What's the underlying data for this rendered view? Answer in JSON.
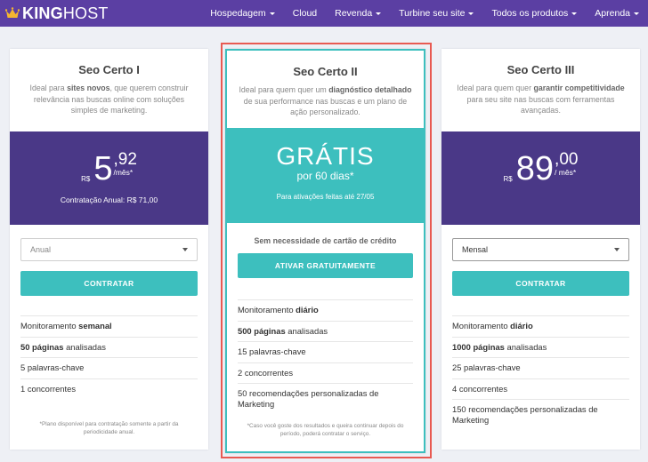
{
  "brand": {
    "name_bold": "KING",
    "name_light": "HOST",
    "crown_color": "#f5b630"
  },
  "colors": {
    "nav": "#5b3fa3",
    "price_box": "#4a3887",
    "accent": "#3dbfbe",
    "highlight_outline": "#e85a52"
  },
  "menu": [
    {
      "label": "Hospedagem",
      "dropdown": true
    },
    {
      "label": "Cloud",
      "dropdown": false
    },
    {
      "label": "Revenda",
      "dropdown": true
    },
    {
      "label": "Turbine seu site",
      "dropdown": true
    },
    {
      "label": "Todos os produtos",
      "dropdown": true
    },
    {
      "label": "Aprenda",
      "dropdown": true
    }
  ],
  "plans": {
    "p1": {
      "title": "Seo Certo I",
      "desc_pre": "Ideal para ",
      "desc_bold": "sites novos",
      "desc_post": ", que querem construir relevância nas buscas online com soluções simples de marketing.",
      "currency": "R$",
      "price_int": "5",
      "price_cents": ",92",
      "period": "/mês*",
      "annual_note": "Contratação Anual: R$ 71,00",
      "select_value": "Anual",
      "button": "CONTRATAR",
      "features": [
        {
          "pre": "Monitoramento ",
          "bold": "semanal",
          "post": ""
        },
        {
          "pre": "",
          "bold": "50 páginas",
          "post": " analisadas"
        },
        {
          "pre": "5 palavras-chave",
          "bold": "",
          "post": ""
        },
        {
          "pre": "1 concorrentes",
          "bold": "",
          "post": ""
        }
      ],
      "footnote": "*Plano disponível para contratação somente a partir da periodicidade anual."
    },
    "p2": {
      "title": "Seo Certo II",
      "desc_pre": "Ideal para quem quer um ",
      "desc_bold": "diagnóstico detalhado",
      "desc_post": " de sua performance nas buscas e um plano de ação personalizado.",
      "free_label": "GRÁTIS",
      "free_period": "por 60 dias*",
      "activation_note": "Para ativações feitas até 27/05",
      "no_card": "Sem necessidade de cartão de crédito",
      "button": "ATIVAR GRATUITAMENTE",
      "features": [
        {
          "pre": "Monitoramento ",
          "bold": "diário",
          "post": ""
        },
        {
          "pre": "",
          "bold": "500 páginas",
          "post": " analisadas"
        },
        {
          "pre": "15 palavras-chave",
          "bold": "",
          "post": ""
        },
        {
          "pre": "2 concorrentes",
          "bold": "",
          "post": ""
        },
        {
          "pre": "50 recomendações personalizadas de Marketing",
          "bold": "",
          "post": ""
        }
      ],
      "footnote": "*Caso você goste dos resultados e queira continuar depois do período, poderá contratar o serviço."
    },
    "p3": {
      "title": "Seo Certo III",
      "desc_pre": "Ideal para quem quer ",
      "desc_bold": "garantir competitividade",
      "desc_post": " para seu site nas buscas com ferramentas avançadas.",
      "currency": "R$",
      "price_int": "89",
      "price_cents": ",00",
      "period": "/ mês*",
      "select_value": "Mensal",
      "button": "CONTRATAR",
      "features": [
        {
          "pre": "Monitoramento ",
          "bold": "diário",
          "post": ""
        },
        {
          "pre": "",
          "bold": "1000 páginas",
          "post": " analisadas"
        },
        {
          "pre": "25 palavras-chave",
          "bold": "",
          "post": ""
        },
        {
          "pre": "4 concorrentes",
          "bold": "",
          "post": ""
        },
        {
          "pre": "150 recomendações personalizadas de Marketing",
          "bold": "",
          "post": ""
        }
      ]
    }
  }
}
